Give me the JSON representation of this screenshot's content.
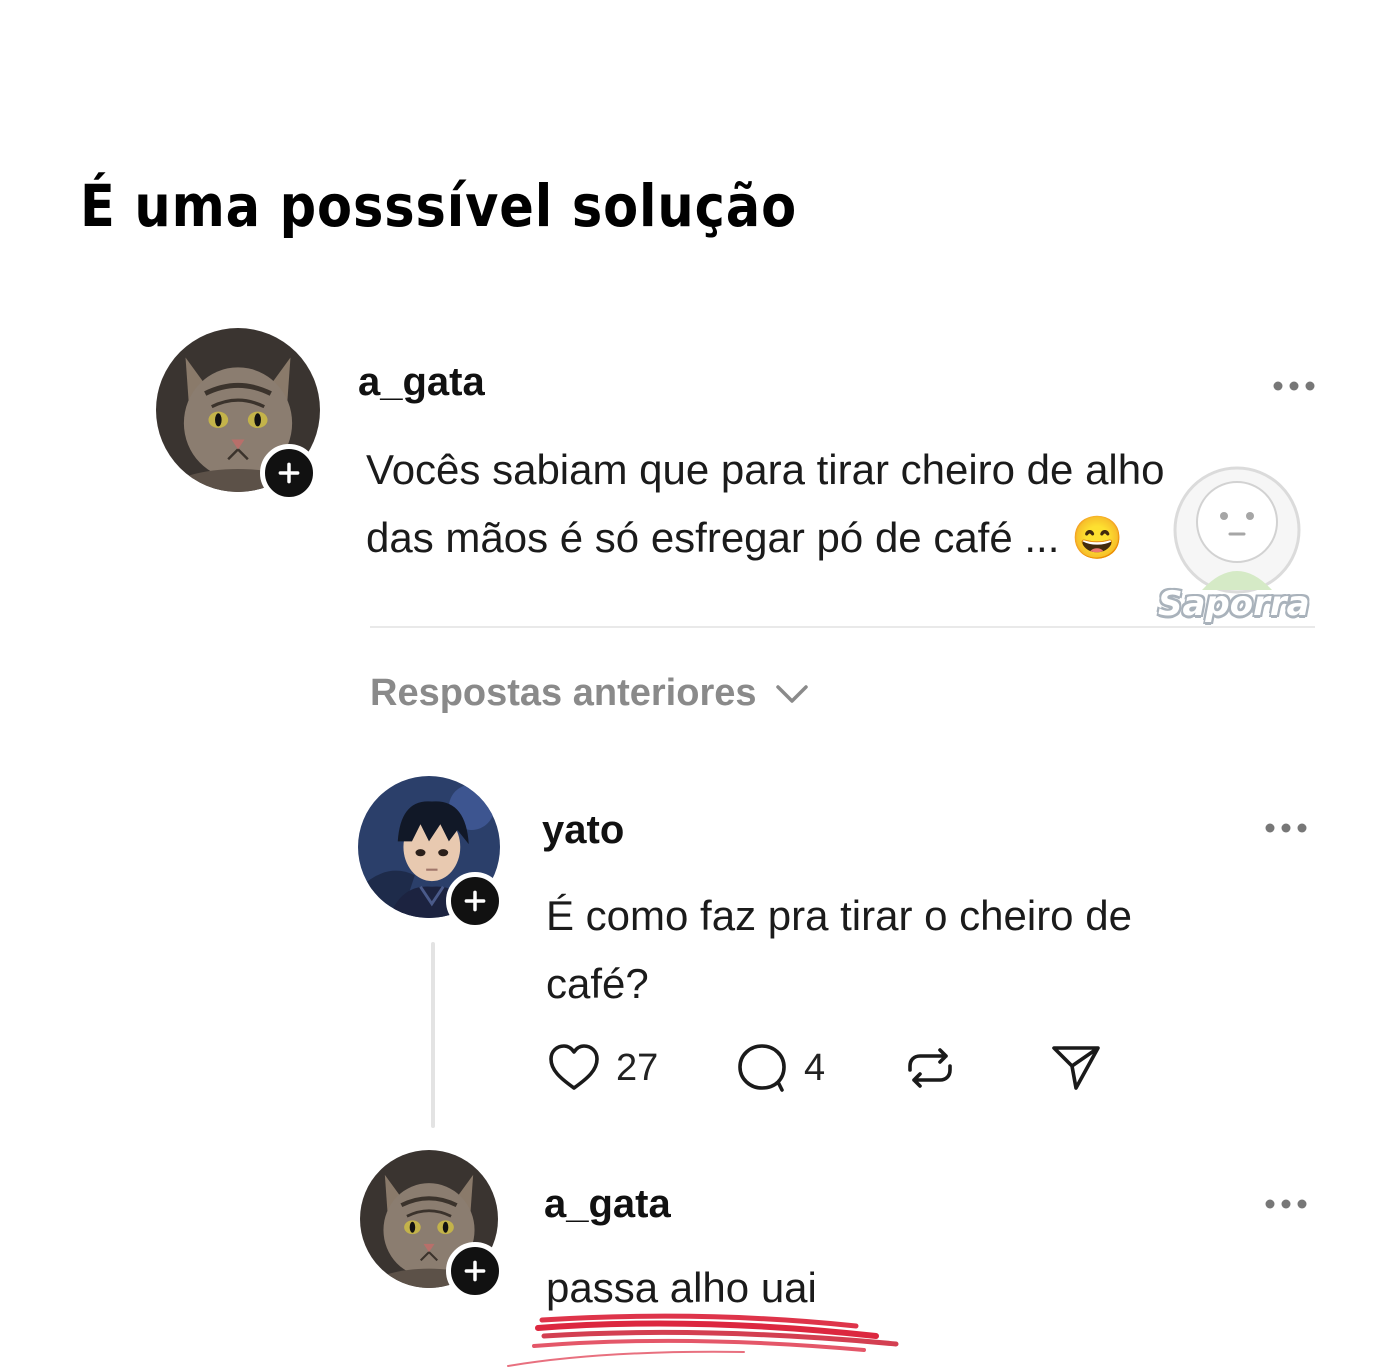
{
  "caption": "É uma posssível solução",
  "post": {
    "username": "a_gata",
    "text_line1": "Vocês sabiam que para tirar cheiro de alho",
    "text_line2": "das mãos é só esfregar pó de café ... 😄"
  },
  "previous_replies_label": "Respostas anteriores",
  "reply1": {
    "username": "yato",
    "text_line1": "É como faz pra tirar o cheiro de",
    "text_line2": "café?",
    "likes": "27",
    "comments": "4"
  },
  "reply2": {
    "username": "a_gata",
    "text": "passa alho uai"
  },
  "watermark": "Saporra",
  "colors": {
    "underline": "#d8102a",
    "muted_text": "#8a8a8a"
  }
}
